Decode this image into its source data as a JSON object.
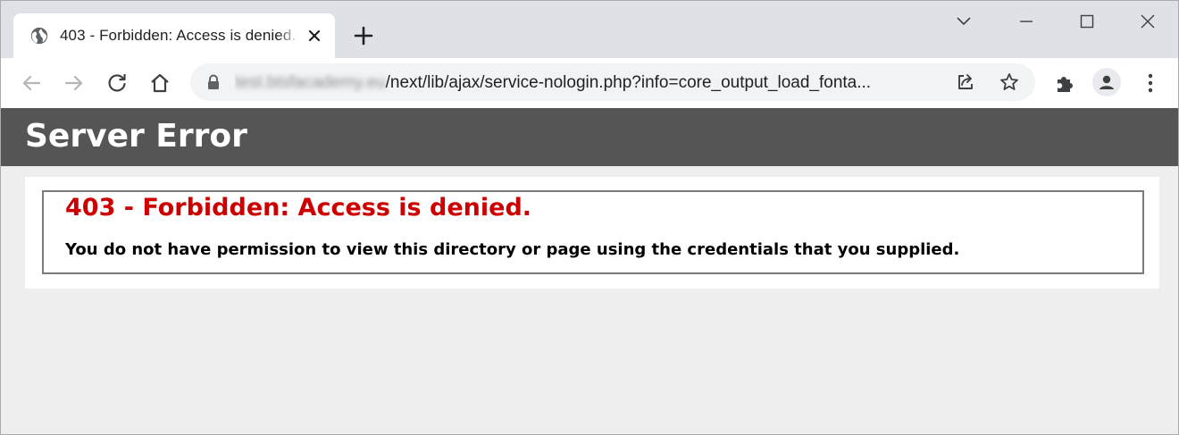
{
  "browser": {
    "tab": {
      "title": "403 - Forbidden: Access is denied."
    },
    "address_bar": {
      "host": "test.btsfacademy.eu",
      "path": "/next/lib/ajax/service-nologin.php?info=core_output_load_fonta..."
    },
    "icons": {
      "tab_favicon": "globe-icon",
      "tab_close": "close-icon",
      "new_tab": "plus-icon",
      "tab_search": "chevron-down-icon",
      "minimize": "minimize-icon",
      "maximize": "maximize-icon",
      "close_window": "close-icon",
      "back": "back-arrow-icon",
      "forward": "forward-arrow-icon",
      "reload": "reload-icon",
      "home": "home-icon",
      "lock": "lock-icon",
      "share": "share-icon",
      "bookmark": "star-icon",
      "extensions": "puzzle-icon",
      "profile": "profile-icon",
      "menu": "kebab-menu-icon"
    }
  },
  "page": {
    "header": "Server Error",
    "error_title": "403 - Forbidden: Access is denied.",
    "error_message": "You do not have permission to view this directory or page using the credentials that you supplied."
  },
  "colors": {
    "tabstrip_bg": "#dee1e6",
    "header_bg": "#555555",
    "error_title": "#cc0000",
    "page_bg": "#eeeeee"
  }
}
